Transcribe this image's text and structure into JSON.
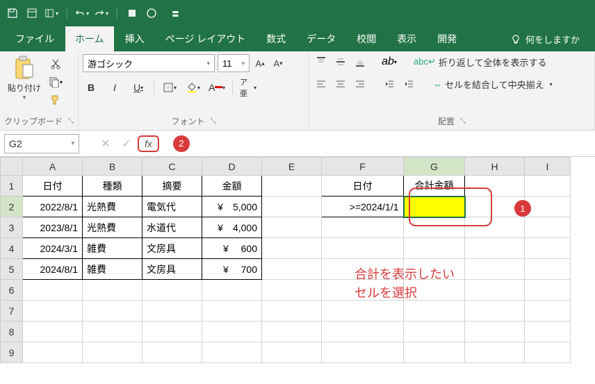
{
  "qat": {
    "customize": "▾"
  },
  "tabs": {
    "file": "ファイル",
    "home": "ホーム",
    "insert": "挿入",
    "page": "ページ レイアウト",
    "formula": "数式",
    "data": "データ",
    "review": "校閲",
    "view": "表示",
    "dev": "開発",
    "tellme": "何をしますか"
  },
  "groups": {
    "clipboard": "クリップボード",
    "font": "フォント",
    "alignment": "配置"
  },
  "clipboard": {
    "paste": "貼り付け"
  },
  "font": {
    "name": "游ゴシック",
    "size": "11"
  },
  "align": {
    "wrap": "折り返して全体を表示する",
    "merge": "セルを結合して中央揃え"
  },
  "nameBox": "G2",
  "fx": "fx",
  "callouts": {
    "c1": "1",
    "c2": "2"
  },
  "columns": [
    "A",
    "B",
    "C",
    "D",
    "E",
    "F",
    "G",
    "H",
    "I"
  ],
  "rows": [
    "1",
    "2",
    "3",
    "4",
    "5",
    "6",
    "7",
    "8",
    "9"
  ],
  "headers": {
    "date": "日付",
    "type": "種類",
    "desc": "摘要",
    "amount": "金額",
    "date2": "日付",
    "total": "合計金額"
  },
  "data": {
    "r1": {
      "date": "2022/8/1",
      "type": "光熱費",
      "desc": "電気代",
      "amount": "¥　5,000"
    },
    "r2": {
      "date": "2023/8/1",
      "type": "光熱費",
      "desc": "水道代",
      "amount": "¥　4,000"
    },
    "r3": {
      "date": "2024/3/1",
      "type": "雑費",
      "desc": "文房具",
      "amount": "¥　 600"
    },
    "r4": {
      "date": "2024/8/1",
      "type": "雑費",
      "desc": "文房具",
      "amount": "¥　 700"
    },
    "f2": ">=2024/1/1"
  },
  "annotation": {
    "line1": "合計を表示したい",
    "line2": "セルを選択"
  }
}
